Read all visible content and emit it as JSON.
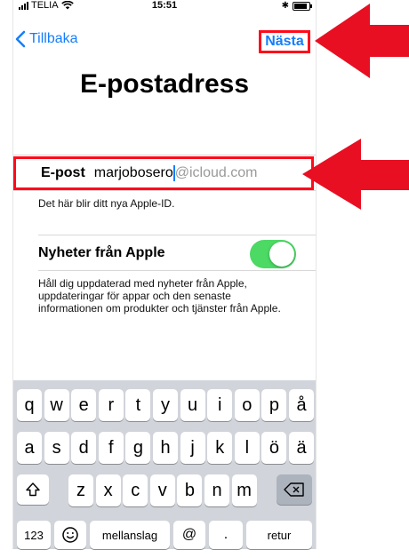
{
  "status_bar": {
    "carrier": "TELIA",
    "time": "15:51"
  },
  "nav": {
    "back_label": "Tillbaka",
    "next_label": "Nästa"
  },
  "title": "E-postadress",
  "email": {
    "label": "E-post",
    "value": "marjobosero",
    "suffix": "@icloud.com"
  },
  "hint": "Det här blir ditt nya Apple-ID.",
  "news": {
    "label": "Nyheter från Apple",
    "enabled": true,
    "description": "Håll dig uppdaterad med nyheter från Apple, uppdateringar för appar och den senaste informationen om produkter och tjänster från Apple."
  },
  "keyboard": {
    "row1": [
      "q",
      "w",
      "e",
      "r",
      "t",
      "y",
      "u",
      "i",
      "o",
      "p",
      "å"
    ],
    "row2": [
      "a",
      "s",
      "d",
      "f",
      "g",
      "h",
      "j",
      "k",
      "l",
      "ö",
      "ä"
    ],
    "row3": [
      "z",
      "x",
      "c",
      "v",
      "b",
      "n",
      "m"
    ],
    "numbers_label": "123",
    "space_label": "mellanslag",
    "at_label": "@",
    "dot_label": ".",
    "return_label": "retur"
  },
  "colors": {
    "accent": "#157efb",
    "highlight": "#ff0a1b",
    "toggle_on": "#4cd964",
    "keyboard_bg": "#d1d4da"
  }
}
